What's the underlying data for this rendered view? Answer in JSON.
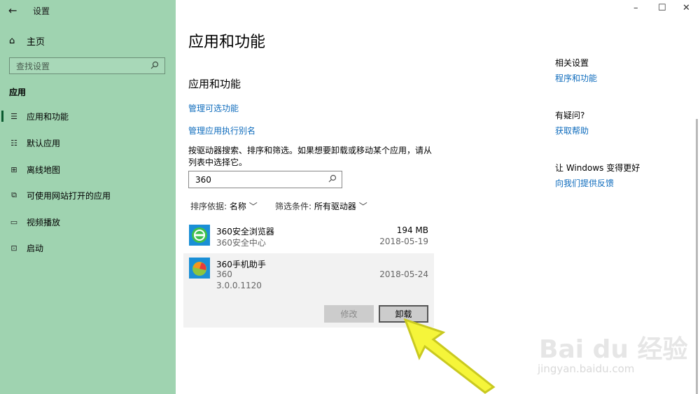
{
  "window": {
    "title": "设置",
    "back": "←",
    "controls": {
      "minimize": "–",
      "maximize": "☐",
      "close": "✕"
    }
  },
  "sidebar": {
    "home": "主页",
    "search_placeholder": "查找设置",
    "section": "应用",
    "items": [
      {
        "label": "应用和功能",
        "icon": "apps-features-icon",
        "active": true
      },
      {
        "label": "默认应用",
        "icon": "default-apps-icon",
        "active": false
      },
      {
        "label": "离线地图",
        "icon": "offline-maps-icon",
        "active": false
      },
      {
        "label": "可使用网站打开的应用",
        "icon": "apps-for-websites-icon",
        "active": false
      },
      {
        "label": "视频播放",
        "icon": "video-playback-icon",
        "active": false
      },
      {
        "label": "启动",
        "icon": "startup-icon",
        "active": false
      }
    ]
  },
  "main": {
    "title": "应用和功能",
    "subtitle": "应用和功能",
    "links": [
      "管理可选功能",
      "管理应用执行别名"
    ],
    "description": "按驱动器搜索、排序和筛选。如果想要卸载或移动某个应用，请从列表中选择它。",
    "filter_value": "360",
    "sort_label": "排序依据:",
    "sort_value": "名称",
    "filter_label": "筛选条件:",
    "filter_drive": "所有驱动器",
    "apps": [
      {
        "name": "360安全浏览器",
        "publisher": "360安全中心",
        "size": "194 MB",
        "date": "2018-05-19"
      },
      {
        "name": "360手机助手",
        "publisher": "360",
        "version": "3.0.0.1120",
        "date": "2018-05-24",
        "selected": true
      }
    ],
    "modify_button": "修改",
    "uninstall_button": "卸载"
  },
  "related": {
    "heading1": "相关设置",
    "link1": "程序和功能",
    "heading2": "有疑问?",
    "link2": "获取帮助",
    "heading3": "让 Windows 变得更好",
    "link3": "向我们提供反馈"
  },
  "watermark": {
    "brand": "Bai du 经验",
    "url": "jingyan.baidu.com"
  },
  "colors": {
    "sidebar": "#9fd3b0",
    "link": "#0f6cbd",
    "selected_row": "#f2f2f2",
    "arrow": "#f2f24a"
  }
}
